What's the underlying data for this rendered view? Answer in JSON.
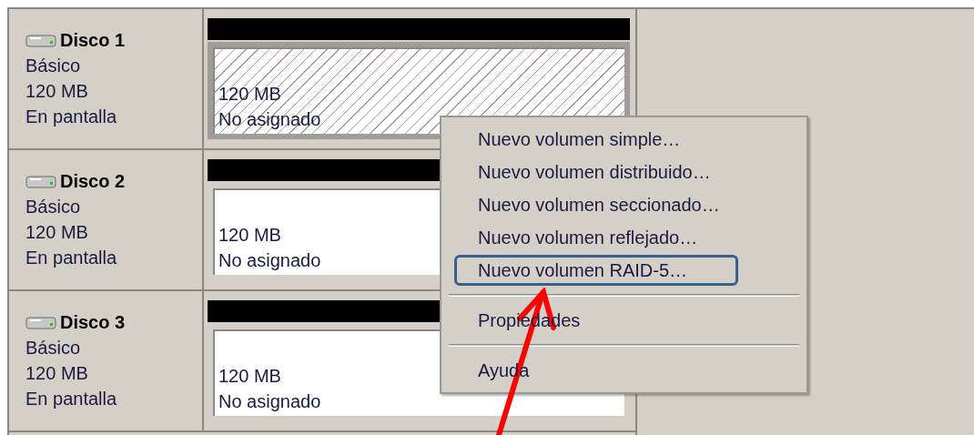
{
  "disks": [
    {
      "name": "Disco 1",
      "type": "Básico",
      "size": "120 MB",
      "status": "En pantalla",
      "partition": {
        "size": "120 MB",
        "status": "No asignado",
        "selected": true
      }
    },
    {
      "name": "Disco 2",
      "type": "Básico",
      "size": "120 MB",
      "status": "En pantalla",
      "partition": {
        "size": "120 MB",
        "status": "No asignado",
        "selected": false
      }
    },
    {
      "name": "Disco 3",
      "type": "Básico",
      "size": "120 MB",
      "status": "En pantalla",
      "partition": {
        "size": "120 MB",
        "status": "No asignado",
        "selected": false
      }
    }
  ],
  "context_menu": [
    {
      "kind": "item",
      "label": "Nuevo volumen simple…",
      "circled": false
    },
    {
      "kind": "item",
      "label": "Nuevo volumen distribuido…",
      "circled": false
    },
    {
      "kind": "item",
      "label": "Nuevo volumen seccionado…",
      "circled": false
    },
    {
      "kind": "item",
      "label": "Nuevo volumen reflejado…",
      "circled": false
    },
    {
      "kind": "item",
      "label": "Nuevo volumen RAID-5…",
      "circled": true
    },
    {
      "kind": "separator"
    },
    {
      "kind": "item",
      "label": "Propiedades",
      "circled": false
    },
    {
      "kind": "separator"
    },
    {
      "kind": "item",
      "label": "Ayuda",
      "circled": false
    }
  ]
}
